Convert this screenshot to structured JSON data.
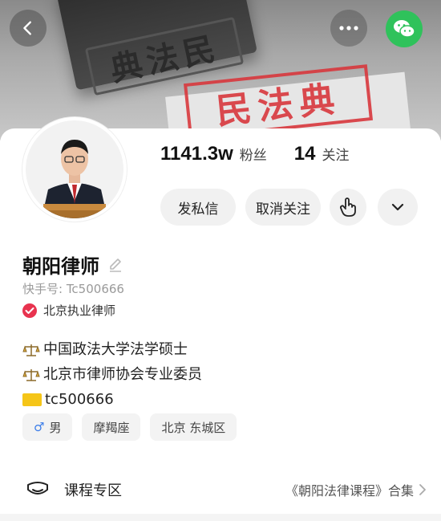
{
  "banner": {
    "stamp_text": "民法典",
    "stamp_block_text": "典法民"
  },
  "header": {
    "back_icon": "chevron-left-icon",
    "more_icon": "more-dots-icon",
    "share_icon": "wechat-icon",
    "share_color": "#2fc25b"
  },
  "profile": {
    "followers_count": "1141.3w",
    "followers_label": "粉丝",
    "following_count": "14",
    "following_label": "关注",
    "name": "朝阳律师",
    "kuaishou_id": "快手号: Tc500666",
    "verification": "北京执业律师",
    "verification_color": "#e8334f"
  },
  "actions": {
    "message_label": "发私信",
    "unfollow_label": "取消关注",
    "hand_icon": "hand-tap-icon",
    "more_icon": "chevron-down-icon"
  },
  "bio": {
    "line1": "中国政法大学法学硕士",
    "line2": "北京市律师协会专业委员",
    "line3": "tc500666"
  },
  "tags": {
    "gender": "男",
    "zodiac": "摩羯座",
    "location": "北京 东城区"
  },
  "course": {
    "title": "课程专区",
    "collection": "《朝阳法律课程》合集"
  }
}
